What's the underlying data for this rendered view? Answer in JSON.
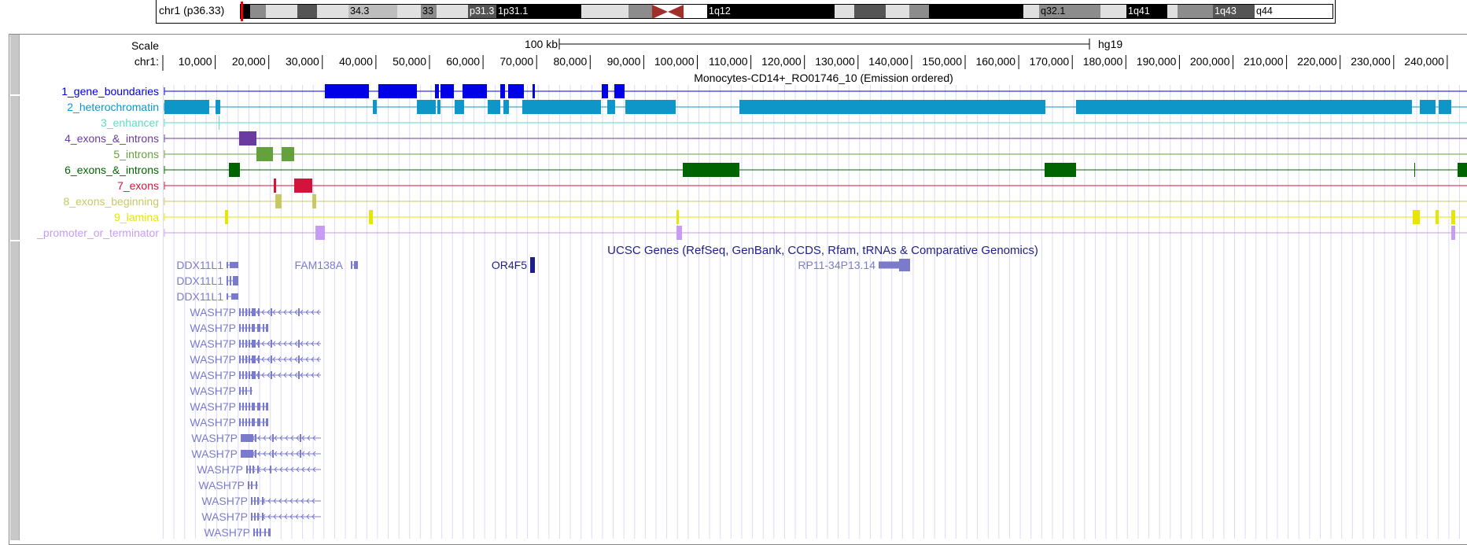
{
  "ideogram": {
    "chrom_label": "chr1 (p36.33)",
    "bands": [
      {
        "label": "",
        "color": "#000000"
      },
      {
        "label": "",
        "color": "#8c8c8c"
      },
      {
        "label": "",
        "color": "#e0e0e0"
      },
      {
        "label": "",
        "color": "#555555"
      },
      {
        "label": "",
        "color": "#e0e0e0"
      },
      {
        "label": "34.3",
        "color": "#bdbdbd"
      },
      {
        "label": "",
        "color": "#e0e0e0"
      },
      {
        "label": "33",
        "color": "#8c8c8c"
      },
      {
        "label": "",
        "color": "#e0e0e0"
      },
      {
        "label": "p31.3",
        "color": "#555555"
      },
      {
        "label": "1p31.1",
        "color": "#000000"
      },
      {
        "label": "",
        "color": "#e0e0e0"
      },
      {
        "label": "",
        "color": "#8c8c8c"
      },
      {
        "label": "",
        "color": "#ffffff"
      },
      {
        "label": "1q12",
        "color": "#000000"
      },
      {
        "label": "",
        "color": "#e0e0e0"
      },
      {
        "label": "",
        "color": "#555555"
      },
      {
        "label": "",
        "color": "#e0e0e0"
      },
      {
        "label": "",
        "color": "#8c8c8c"
      },
      {
        "label": "",
        "color": "#000000"
      },
      {
        "label": "",
        "color": "#e0e0e0"
      },
      {
        "label": "q32.1",
        "color": "#8c8c8c"
      },
      {
        "label": "",
        "color": "#e0e0e0"
      },
      {
        "label": "1q41",
        "color": "#000000"
      },
      {
        "label": "",
        "color": "#e0e0e0"
      },
      {
        "label": "",
        "color": "#8c8c8c"
      },
      {
        "label": "1q43",
        "color": "#555555"
      },
      {
        "label": "q44",
        "color": "#ffffff"
      }
    ],
    "centromere_color": "#a0302a"
  },
  "ruler": {
    "scale_label": "Scale",
    "chrom_label": "chr1:",
    "scale_bar_text": "100 kb",
    "assembly": "hg19",
    "ticks": [
      "10,000",
      "20,000",
      "30,000",
      "40,000",
      "50,000",
      "60,000",
      "70,000",
      "80,000",
      "90,000",
      "100,000",
      "110,000",
      "120,000",
      "130,000",
      "140,000",
      "150,000",
      "160,000",
      "170,000",
      "180,000",
      "190,000",
      "200,000",
      "210,000",
      "220,000",
      "230,000",
      "240,000"
    ],
    "grid_color": "#dbdbf4"
  },
  "chromhmm": {
    "title": "Monocytes-CD14+_RO01746_10 (Emission ordered)",
    "tracks": [
      {
        "label": "1_gene_boundaries",
        "color": "#0000e6"
      },
      {
        "label": "2_heterochromatin",
        "color": "#0e96c8"
      },
      {
        "label": "3_enhancer",
        "color": "#5edcc3"
      },
      {
        "label": "4_exons_&_introns",
        "color": "#6a3aa0"
      },
      {
        "label": "5_introns",
        "color": "#64a03c"
      },
      {
        "label": "6_exons_&_introns",
        "color": "#006400"
      },
      {
        "label": "7_exons",
        "color": "#d2143c"
      },
      {
        "label": "8_exons_beginning",
        "color": "#c8c864"
      },
      {
        "label": "9_lamina",
        "color": "#e6e600"
      },
      {
        "label": "_promoter_or_terminator",
        "color": "#c89bf5"
      }
    ]
  },
  "genes": {
    "title": "UCSC Genes (RefSeq, GenBank, CCDS, Rfam, tRNAs & Comparative Genomics)",
    "gene_color": "#7b7bcc",
    "title_color": "#1e1e8c",
    "items": [
      {
        "name": "DDX11L1"
      },
      {
        "name": "DDX11L1"
      },
      {
        "name": "DDX11L1"
      },
      {
        "name": "WASH7P"
      },
      {
        "name": "WASH7P"
      },
      {
        "name": "WASH7P"
      },
      {
        "name": "WASH7P"
      },
      {
        "name": "WASH7P"
      },
      {
        "name": "WASH7P"
      },
      {
        "name": "WASH7P"
      },
      {
        "name": "WASH7P"
      },
      {
        "name": "WASH7P"
      },
      {
        "name": "WASH7P"
      },
      {
        "name": "WASH7P"
      },
      {
        "name": "WASH7P"
      },
      {
        "name": "WASH7P"
      },
      {
        "name": "WASH7P"
      },
      {
        "name": "WASH7P"
      },
      {
        "name": "FAM138A"
      },
      {
        "name": "OR4F5"
      },
      {
        "name": "RP11-34P13.14"
      }
    ]
  }
}
